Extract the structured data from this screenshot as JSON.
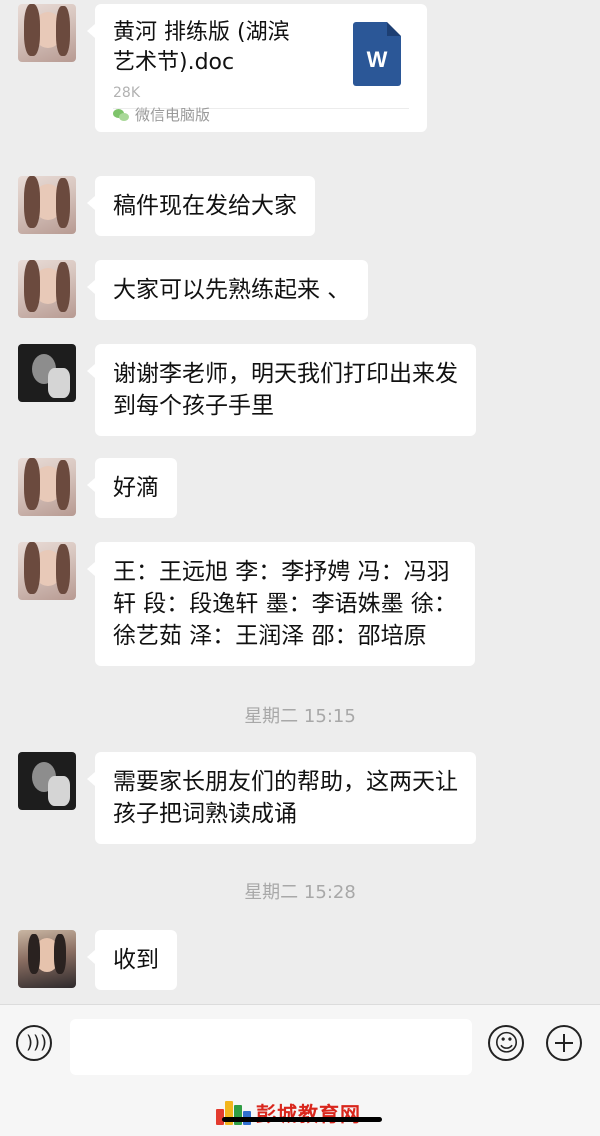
{
  "messages": [
    {
      "type": "file",
      "file_name": "黄河 排练版 (湖滨\n艺术节).doc",
      "file_size": "28K",
      "file_type": "W",
      "source": "微信电脑版"
    },
    {
      "type": "text",
      "text": "稿件现在发给大家"
    },
    {
      "type": "text",
      "text": "大家可以先熟练起来 、"
    },
    {
      "type": "text",
      "text": "谢谢李老师，明天我们打印出来发\n到每个孩子手里"
    },
    {
      "type": "text",
      "text": "好滴"
    },
    {
      "type": "text",
      "text": "王：王远旭 李：李抒娉 冯：冯羽\n轩 段：段逸轩 墨：李语姝墨 徐：\n徐艺茹 泽：王润泽 邵：邵培原"
    },
    {
      "type": "text",
      "text": "需要家长朋友们的帮助，这两天让\n孩子把词熟读成诵"
    },
    {
      "type": "text",
      "text": "收到"
    }
  ],
  "timestamps": [
    "星期二 15:15",
    "星期二 15:28"
  ],
  "input_bar": {
    "voice_icon": "voice-icon",
    "emoji_icon": "emoji-icon",
    "plus_icon": "plus-icon",
    "input_value": ""
  },
  "watermark": {
    "text": "彭城教育网"
  },
  "colors": {
    "background": "#ededed",
    "bubble": "#ffffff",
    "word_icon": "#2b5797",
    "timestamp": "#a8a8a8",
    "watermark": "#d9261c"
  }
}
